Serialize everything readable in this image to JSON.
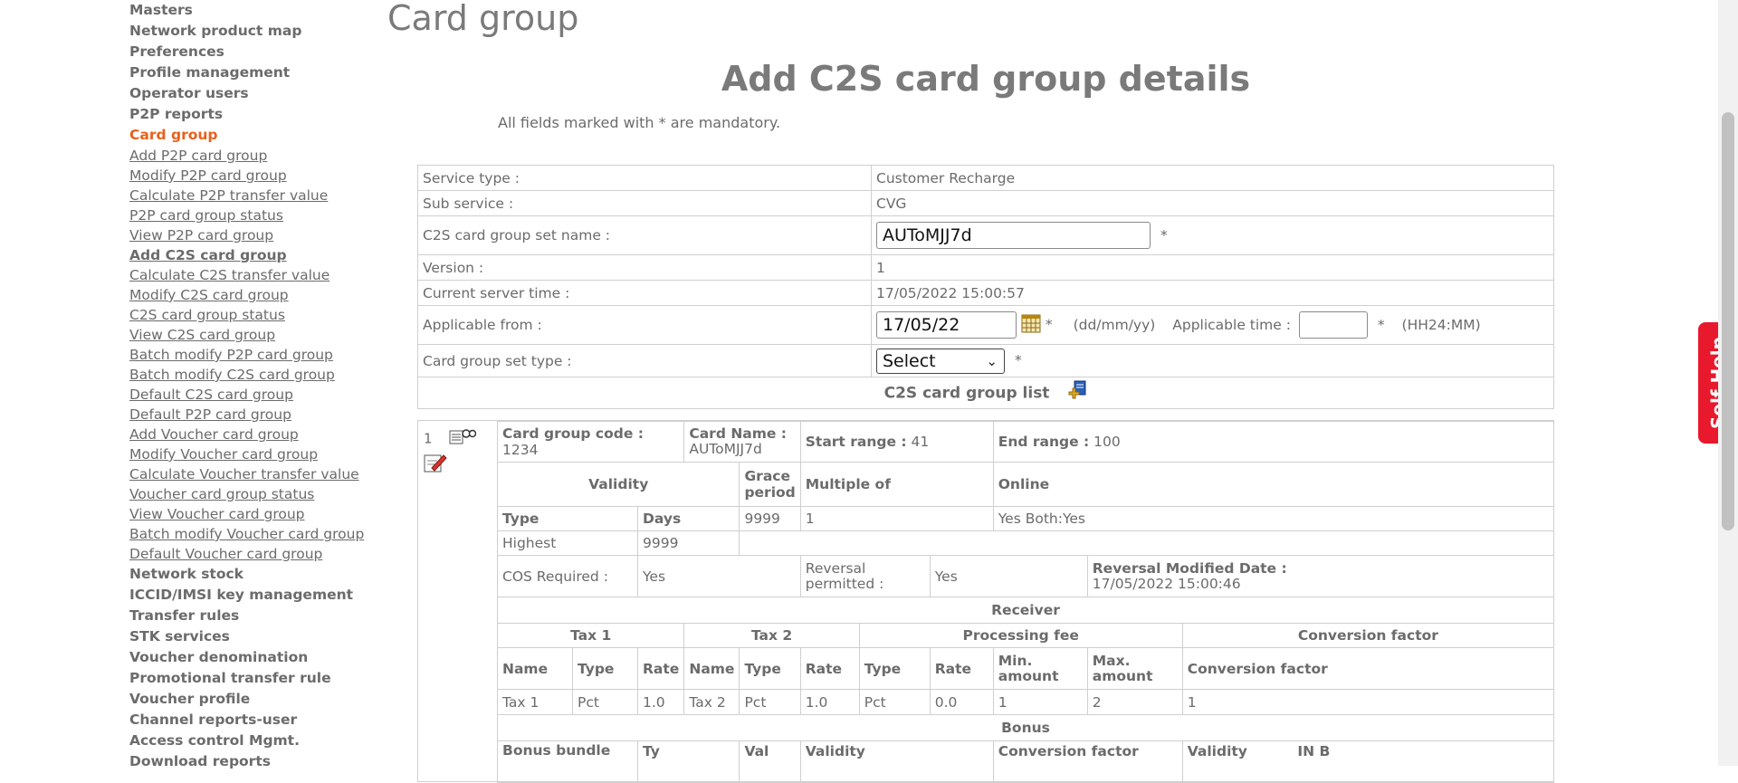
{
  "sidebar": {
    "top_items": [
      "Masters",
      "Network product map",
      "Preferences",
      "Profile management",
      "Operator users",
      "P2P reports"
    ],
    "active": "Card group",
    "sub_items": [
      "Add P2P card group",
      "Modify P2P card group",
      "Calculate P2P transfer value",
      "P2P card group status",
      "View P2P card group",
      "Add C2S card group",
      "Calculate C2S transfer value",
      "Modify C2S card group",
      "C2S card group status",
      "View C2S card group",
      "Batch modify P2P card group",
      "Batch modify C2S card group",
      "Default C2S card group",
      "Default P2P card group",
      "Add Voucher card group",
      "Modify Voucher card group",
      "Calculate Voucher transfer value",
      "Voucher card group status",
      "View Voucher card group",
      "Batch modify Voucher card group",
      "Default Voucher card group"
    ],
    "bottom_items": [
      "Network stock",
      "ICCID/IMSI key management",
      "Transfer rules",
      "STK services",
      "Voucher denomination",
      "Promotional transfer rule",
      "Voucher profile",
      "Channel reports-user",
      "Access control Mgmt.",
      "Download reports"
    ]
  },
  "page_title": "Card group",
  "form_title": "Add C2S card group details",
  "mandatory_note": "All fields marked with * are mandatory.",
  "form": {
    "service_type_label": "Service type :",
    "service_type_value": "Customer Recharge",
    "sub_service_label": "Sub service :",
    "sub_service_value": "CVG",
    "set_name_label": "C2S card group set name :",
    "set_name_value": "AUToMJJ7d",
    "version_label": "Version :",
    "version_value": "1",
    "server_time_label": "Current server time :",
    "server_time_value": "17/05/2022 15:00:57",
    "applicable_from_label": "Applicable from :",
    "applicable_from_value": "17/05/22",
    "date_format": "(dd/mm/yy)",
    "applicable_time_label": "Applicable time :",
    "applicable_time_value": "",
    "time_format": "(HH24:MM)",
    "set_type_label": "Card group set type :",
    "set_type_selected": "Select",
    "asterisk": "*",
    "list_title": "C2S card group list"
  },
  "detail": {
    "index": "1",
    "card_group_code_label": "Card group code :",
    "card_group_code": "1234",
    "card_name_label": "Card Name :",
    "card_name": "AUToMJJ7d",
    "start_range_label": "Start range :",
    "start_range": "41",
    "end_range_label": "End range :",
    "end_range": "100",
    "validity_h": "Validity",
    "grace_h": "Grace period",
    "multiple_h": "Multiple of",
    "online_h": "Online",
    "type_h": "Type",
    "days_h": "Days",
    "grace_value": "9999",
    "multiple_value": "1",
    "online_value": "Yes Both:Yes",
    "validity_type": "Highest",
    "validity_days": "9999",
    "cos_label": "COS Required :",
    "cos_value": "Yes",
    "reversal_label": "Reversal permitted :",
    "reversal_value": "Yes",
    "rev_mod_label": "Reversal Modified Date :",
    "rev_mod_value": "17/05/2022 15:00:46",
    "receiver_h": "Receiver",
    "tax1_h": "Tax 1",
    "tax2_h": "Tax 2",
    "proc_fee_h": "Processing fee",
    "conv_factor_h": "Conversion factor",
    "name_h": "Name",
    "rate_h": "Rate",
    "min_amount_h": "Min. amount",
    "max_amount_h": "Max. amount",
    "row": [
      "Tax 1",
      "Pct",
      "1.0",
      "Tax 2",
      "Pct",
      "1.0",
      "Pct",
      "0.0",
      "1",
      "2",
      "1"
    ],
    "bonus_h": "Bonus",
    "bonus_bundle_h": "Bonus bundle",
    "partial_headers": [
      "Ty",
      "Val",
      "Validity",
      "Conversion factor",
      "Validity",
      "IN B"
    ]
  },
  "self_help": "Self Help",
  "colors": {
    "accent": "#e8601c",
    "self_help_bg": "#e8192c",
    "text": "#6b6b6b"
  }
}
